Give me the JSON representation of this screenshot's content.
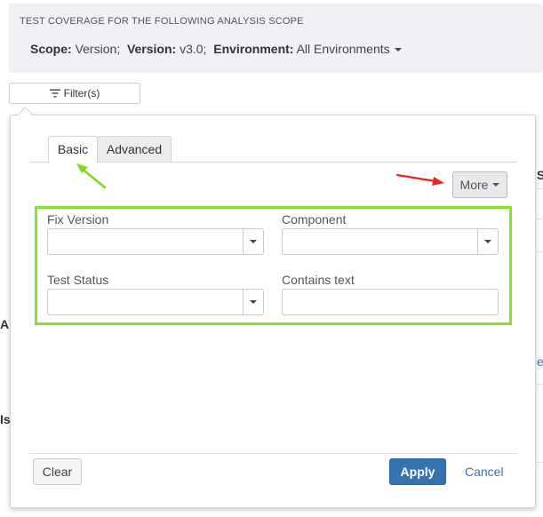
{
  "scope_panel": {
    "heading": "TEST COVERAGE FOR THE FOLLOWING ANALYSIS SCOPE",
    "scope_label": "Scope:",
    "scope_value": "Version;",
    "version_label": "Version:",
    "version_value": "v3.0;",
    "environment_label": "Environment:",
    "environment_value": "All Environments"
  },
  "filters_button": {
    "label": "Filter(s)",
    "icon": "filter-icon"
  },
  "background": {
    "fragments": [
      "A",
      "Is"
    ],
    "link_fragment": "e",
    "column_fragment": "S"
  },
  "filter_popup": {
    "tabs": [
      {
        "label": "Basic",
        "active": true
      },
      {
        "label": "Advanced",
        "active": false
      }
    ],
    "more_button": "More",
    "fields": {
      "fix_version": {
        "label": "Fix Version",
        "value": ""
      },
      "component": {
        "label": "Component",
        "value": ""
      },
      "test_status": {
        "label": "Test Status",
        "value": ""
      },
      "contains_text": {
        "label": "Contains text",
        "value": "",
        "placeholder": ""
      }
    },
    "actions": {
      "clear": "Clear",
      "apply": "Apply",
      "cancel": "Cancel"
    }
  },
  "colors": {
    "highlight_box": "#86e22b",
    "green_arrow": "#7fd81f",
    "red_arrow": "#e8251f",
    "primary_button": "#3572b0",
    "link": "#3b73af"
  }
}
